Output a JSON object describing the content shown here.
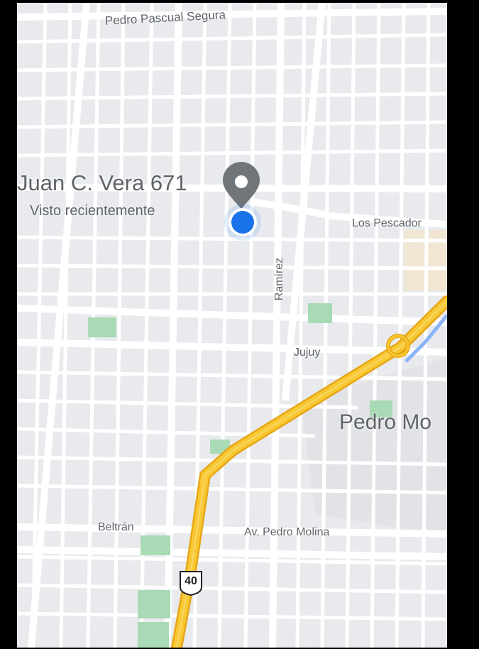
{
  "map": {
    "place": {
      "title": "Juan C. Vera 671",
      "subtitle": "Visto recientemente"
    },
    "streets": {
      "pedro_pascual_segura": "Pedro Pascual Segura",
      "los_pescadores": "Los Pescador",
      "ramirez": "Ramírez",
      "jujuy": "Jujuy",
      "beltran": "Beltrán",
      "av_pedro_molina": "Av. Pedro Molina"
    },
    "district": "Pedro Mo",
    "route_shield": "40",
    "colors": {
      "land": "#e8eaed",
      "street": "#ffffff",
      "park": "#a8dab5",
      "highway": "#f9c933",
      "highway_edge": "#e7a616",
      "pin": "#70757a",
      "location_dot": "#1a73e8",
      "water": "#8ab4f8"
    }
  }
}
